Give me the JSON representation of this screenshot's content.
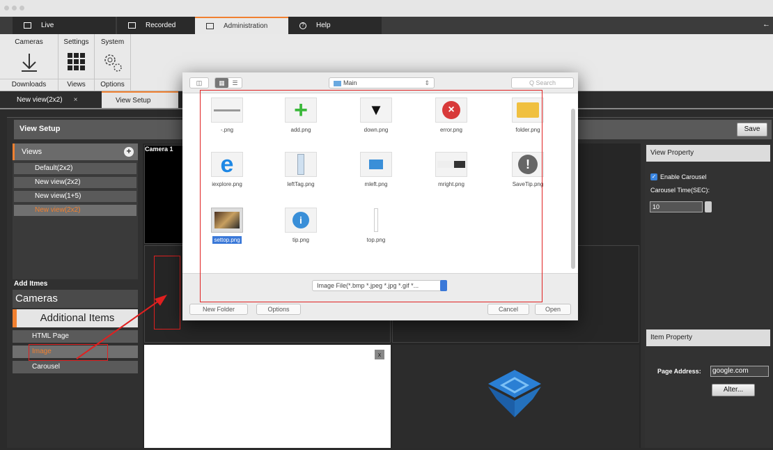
{
  "tabs": [
    {
      "label": "Live"
    },
    {
      "label": "Recorded"
    },
    {
      "label": "Administration"
    },
    {
      "label": "Help"
    }
  ],
  "ribbon": {
    "groups": [
      {
        "title": "Cameras",
        "label": "Downloads"
      },
      {
        "title": "Settings",
        "label": "Views"
      },
      {
        "title": "System",
        "label": "Options"
      }
    ]
  },
  "subtabs": [
    {
      "label": "New view(2x2)"
    },
    {
      "label": "View Setup"
    }
  ],
  "view_setup": {
    "title": "View Setup",
    "save_label": "Save"
  },
  "views": {
    "header": "Views",
    "items": [
      "Default(2x2)",
      "New view(2x2)",
      "New view(1+5)",
      "New view(2x2)"
    ]
  },
  "add_items": {
    "label": "Add Itmes",
    "categories": [
      "Cameras",
      "Additional Items"
    ],
    "items": [
      "HTML Page",
      "Image",
      "Carousel"
    ]
  },
  "grid": {
    "camera_label": "Camera 1",
    "close_label": "x"
  },
  "view_property": {
    "header": "View Property",
    "enable_carousel": "Enable Carousel",
    "carousel_time_label": "Carousel Time(SEC):",
    "carousel_time_value": "10"
  },
  "item_property": {
    "header": "Item Property",
    "page_address_label": "Page Address:",
    "page_address_value": "google.com",
    "alter_label": "Alter..."
  },
  "dialog": {
    "folder": "Main",
    "search_placeholder": "Q Search",
    "files": [
      "-.png",
      "add.png",
      "down.png",
      "error.png",
      "folder.png",
      "iexplore.png",
      "leftTag.png",
      "mleft.png",
      "mright.png",
      "SaveTip.png",
      "settop.png",
      "tip.png",
      "top.png"
    ],
    "filter": "Image File(*.bmp *.jpeg *.jpg *.gif *...",
    "new_folder": "New Folder",
    "options": "Options",
    "cancel": "Cancel",
    "open": "Open"
  },
  "colors": {
    "accent": "#f08030",
    "selection": "#3a78d8",
    "annotation": "#e02020"
  }
}
